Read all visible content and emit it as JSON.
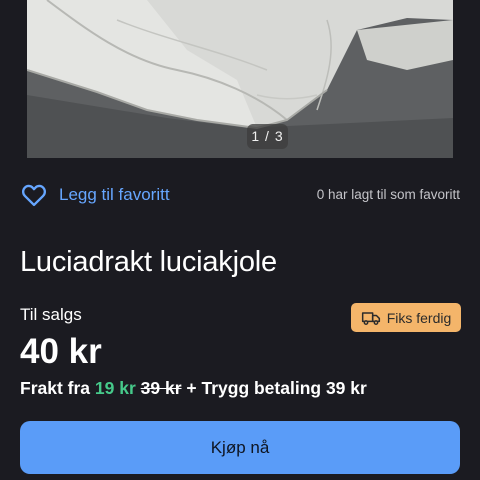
{
  "gallery": {
    "counter": "1 / 3"
  },
  "favorite": {
    "icon": "heart-outline-icon",
    "link_label": "Legg til favoritt",
    "count_text": "0 har lagt til som favoritt"
  },
  "listing": {
    "title": "Luciadrakt luciakjole",
    "sale_label": "Til salgs",
    "badge": {
      "icon": "truck-icon",
      "label": "Fiks ferdig"
    },
    "price": "40 kr",
    "shipping": {
      "prefix": "Frakt fra",
      "price": "19 kr",
      "old_price": "39 kr",
      "suffix": "+ Trygg betaling 39 kr"
    }
  },
  "actions": {
    "buy_label": "Kjøp nå"
  },
  "colors": {
    "background": "#1b1b21",
    "link": "#66a6ff",
    "badge_bg": "#f4b56a",
    "shipping_price": "#46c98a",
    "primary_button": "#5a9cf8"
  }
}
